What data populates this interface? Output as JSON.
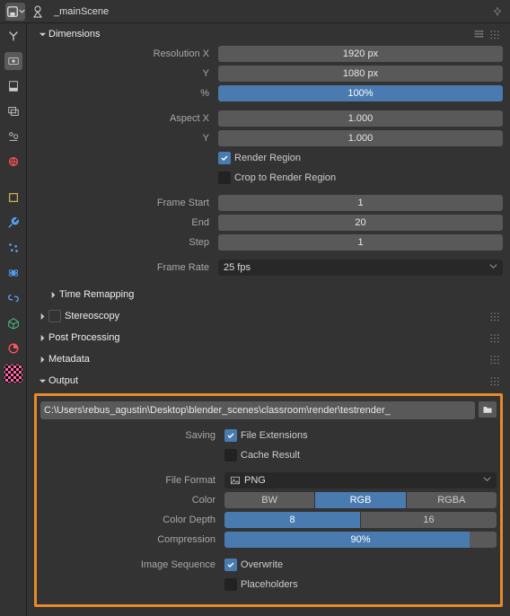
{
  "scene_name": "_mainScene",
  "sections": {
    "dimensions": "Dimensions",
    "time_remapping": "Time Remapping",
    "stereoscopy": "Stereoscopy",
    "post_processing": "Post Processing",
    "metadata": "Metadata",
    "output": "Output"
  },
  "dimensions": {
    "res_x_label": "Resolution X",
    "res_x": "1920 px",
    "res_y_label": "Y",
    "res_y": "1080 px",
    "res_pct_label": "%",
    "res_pct": "100%",
    "aspect_x_label": "Aspect X",
    "aspect_x": "1.000",
    "aspect_y_label": "Y",
    "aspect_y": "1.000",
    "render_region_label": "Render Region",
    "crop_region_label": "Crop to Render Region",
    "frame_start_label": "Frame Start",
    "frame_start": "1",
    "frame_end_label": "End",
    "frame_end": "20",
    "frame_step_label": "Step",
    "frame_step": "1",
    "frame_rate_label": "Frame Rate",
    "frame_rate": "25 fps"
  },
  "output": {
    "path": "C:\\Users\\rebus_agustin\\Desktop\\blender_scenes\\classroom\\render\\testrender_",
    "saving_label": "Saving",
    "file_ext_label": "File Extensions",
    "cache_label": "Cache Result",
    "format_label": "File Format",
    "format": "PNG",
    "color_label": "Color",
    "color_bw": "BW",
    "color_rgb": "RGB",
    "color_rgba": "RGBA",
    "depth_label": "Color Depth",
    "depth_8": "8",
    "depth_16": "16",
    "compression_label": "Compression",
    "compression": "90%",
    "compression_pct": 90,
    "seq_label": "Image Sequence",
    "overwrite_label": "Overwrite",
    "placeholders_label": "Placeholders"
  }
}
